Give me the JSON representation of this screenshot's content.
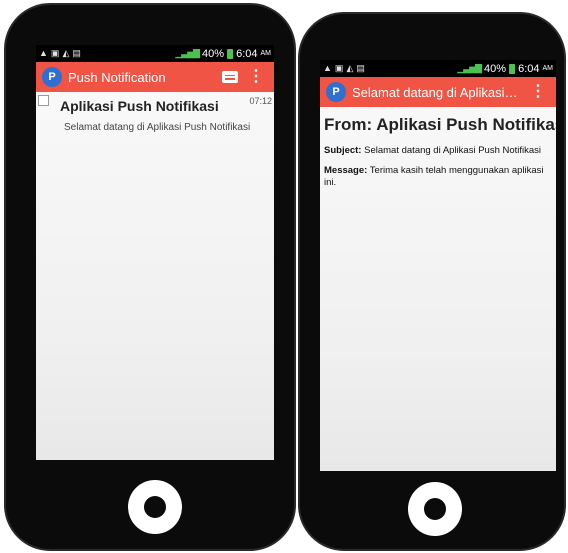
{
  "status_bar": {
    "battery": "40%",
    "time": "6:04",
    "ampm": "AM"
  },
  "screen1": {
    "app_title": "Push Notification",
    "notification": {
      "title": "Aplikasi Push Notifikasi",
      "time": "07:12",
      "body": "Selamat datang di Aplikasi Push Notifikasi"
    }
  },
  "screen2": {
    "app_title": "Selamat datang di Aplikasi P...",
    "from": "From: Aplikasi Push Notifikasi",
    "subject_label": "Subject:",
    "subject": "Selamat datang di Aplikasi Push Notifikasi",
    "message_label": "Message:",
    "message": "Terima kasih telah menggunakan aplikasi ini."
  },
  "icons": {
    "app_logo": "app-logo-icon",
    "menu": "overflow-menu-icon",
    "compose": "message-icon",
    "home": "home-button-icon"
  },
  "colors": {
    "app_bar": "#f05444",
    "logo": "#2f6fd0",
    "signal": "#4ec24e"
  }
}
